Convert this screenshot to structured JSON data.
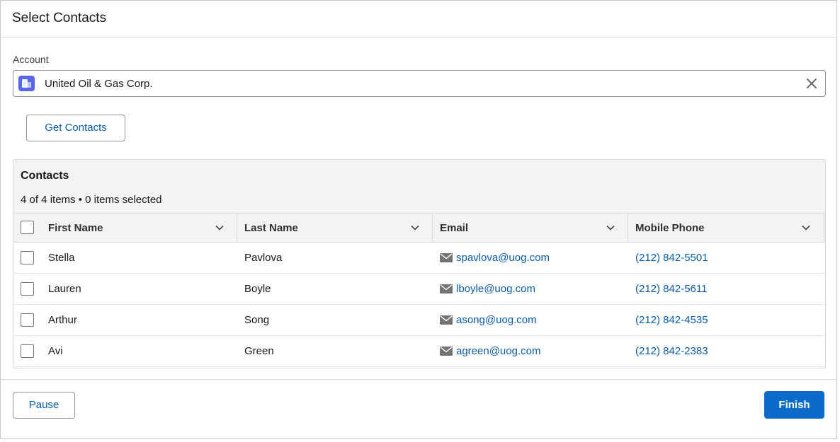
{
  "header": {
    "title": "Select Contacts"
  },
  "account": {
    "label": "Account",
    "value": "United Oil & Gas Corp.",
    "icon": "account-icon",
    "icon_color": "#5867e8"
  },
  "actions": {
    "get_contacts": "Get Contacts"
  },
  "contacts": {
    "title": "Contacts",
    "meta": "4 of 4 items • 0 items selected",
    "columns": [
      "First Name",
      "Last Name",
      "Email",
      "Mobile Phone"
    ],
    "rows": [
      {
        "first": "Stella",
        "last": "Pavlova",
        "email": "spavlova@uog.com",
        "phone": "(212) 842-5501"
      },
      {
        "first": "Lauren",
        "last": "Boyle",
        "email": "lboyle@uog.com",
        "phone": "(212) 842-5611"
      },
      {
        "first": "Arthur",
        "last": "Song",
        "email": "asong@uog.com",
        "phone": "(212) 842-4535"
      },
      {
        "first": "Avi",
        "last": "Green",
        "email": "agreen@uog.com",
        "phone": "(212) 842-2383"
      }
    ]
  },
  "footer": {
    "pause": "Pause",
    "finish": "Finish"
  },
  "colors": {
    "accent": "#0b6bcb",
    "link": "#0b5cab"
  }
}
